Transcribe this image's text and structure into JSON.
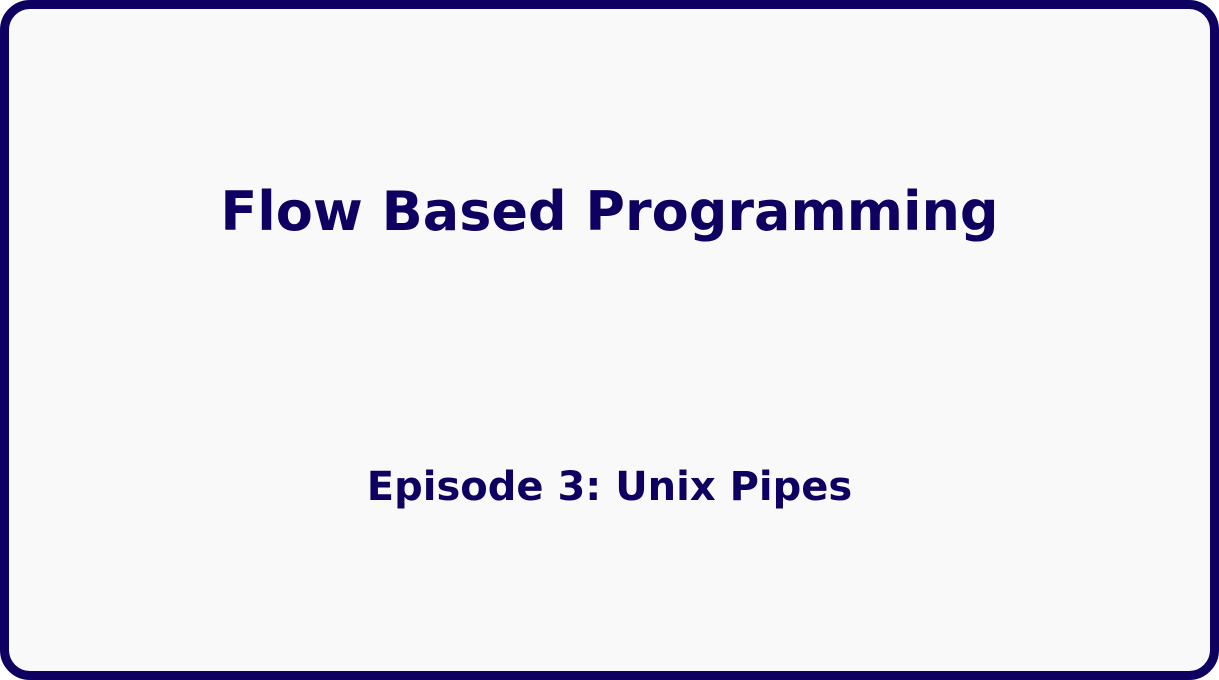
{
  "slide": {
    "title": "Flow Based Programming",
    "subtitle": "Episode 3: Unix Pipes"
  },
  "colors": {
    "border": "#0e0060",
    "text": "#0e0060",
    "background": "#f9f9f9"
  }
}
